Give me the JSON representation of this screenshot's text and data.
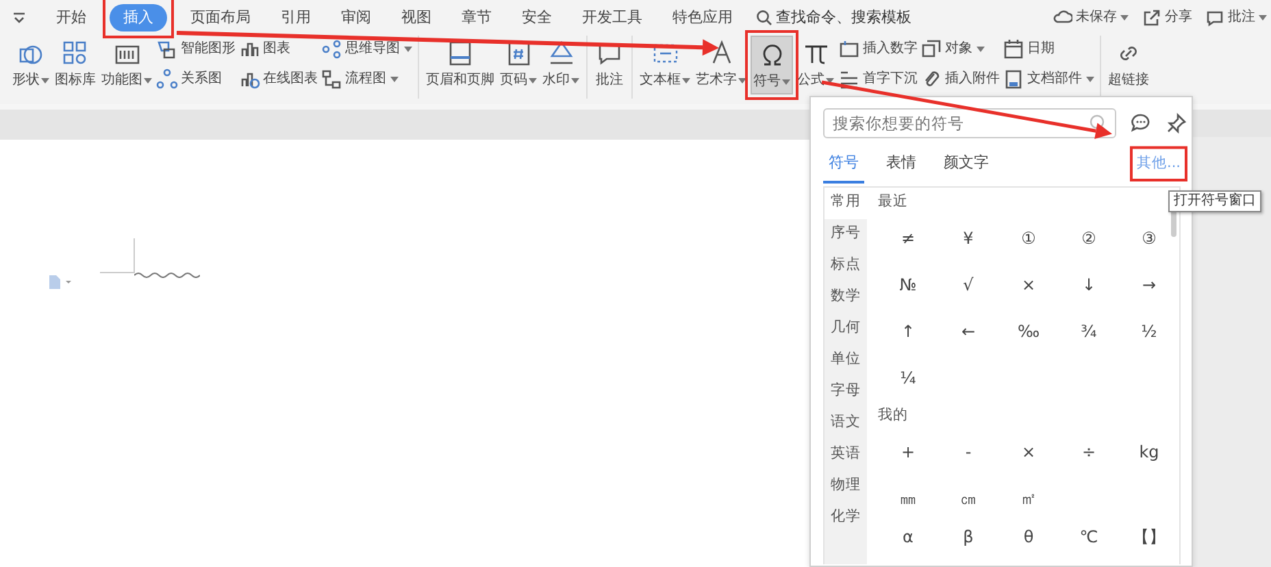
{
  "tabs": [
    {
      "label": "开始",
      "selected": false
    },
    {
      "label": "插入",
      "selected": true
    },
    {
      "label": "页面布局",
      "selected": false
    },
    {
      "label": "引用",
      "selected": false
    },
    {
      "label": "审阅",
      "selected": false
    },
    {
      "label": "视图",
      "selected": false
    },
    {
      "label": "章节",
      "selected": false
    },
    {
      "label": "安全",
      "selected": false
    },
    {
      "label": "开发工具",
      "selected": false
    },
    {
      "label": "特色应用",
      "selected": false
    }
  ],
  "command_search": "查找命令、搜索模板",
  "top_actions": [
    {
      "label": "未保存",
      "dropdown": true
    },
    {
      "label": "分享",
      "dropdown": false
    },
    {
      "label": "批注",
      "dropdown": true
    }
  ],
  "ribbon_groups": [
    {
      "items": [
        {
          "kind": "large",
          "label": "形状",
          "dropdown": true,
          "pressed": false
        },
        {
          "kind": "large",
          "label": "图标库",
          "dropdown": false,
          "pressed": false
        },
        {
          "kind": "large",
          "label": "功能图",
          "dropdown": true,
          "pressed": false
        },
        {
          "kind": "small",
          "label": "智能图形",
          "dropdown": false
        },
        {
          "kind": "small",
          "label": "关系图",
          "dropdown": false
        },
        {
          "kind": "small",
          "label": "图表",
          "dropdown": false
        },
        {
          "kind": "small",
          "label": "在线图表",
          "dropdown": false
        },
        {
          "kind": "small",
          "label": "思维导图",
          "dropdown": true
        },
        {
          "kind": "small",
          "label": "流程图",
          "dropdown": true
        }
      ]
    },
    {
      "items": [
        {
          "kind": "large",
          "label": "页眉和页脚",
          "dropdown": false,
          "pressed": false
        },
        {
          "kind": "large",
          "label": "页码",
          "dropdown": true,
          "pressed": false
        },
        {
          "kind": "large",
          "label": "水印",
          "dropdown": true,
          "pressed": false
        }
      ]
    },
    {
      "items": [
        {
          "kind": "large",
          "label": "批注",
          "dropdown": false,
          "pressed": false
        }
      ]
    },
    {
      "items": [
        {
          "kind": "large",
          "label": "文本框",
          "dropdown": true,
          "pressed": false
        },
        {
          "kind": "large",
          "label": "艺术字",
          "dropdown": true,
          "pressed": false
        },
        {
          "kind": "large",
          "label": "符号",
          "dropdown": true,
          "pressed": true
        },
        {
          "kind": "large",
          "label": "公式",
          "dropdown": true,
          "pressed": false
        },
        {
          "kind": "small",
          "label": "插入数字",
          "dropdown": false
        },
        {
          "kind": "small",
          "label": "首字下沉",
          "dropdown": false
        },
        {
          "kind": "small",
          "label": "对象",
          "dropdown": true
        },
        {
          "kind": "small",
          "label": "插入附件",
          "dropdown": false
        },
        {
          "kind": "small",
          "label": "日期",
          "dropdown": false
        },
        {
          "kind": "small",
          "label": "文档部件",
          "dropdown": true
        }
      ]
    },
    {
      "items": [
        {
          "kind": "large",
          "label": "超链接",
          "dropdown": false,
          "pressed": false
        }
      ]
    }
  ],
  "symbol_panel": {
    "search": {
      "placeholder": "搜索你想要的符号"
    },
    "tabs": [
      {
        "label": "符号",
        "selected": true
      },
      {
        "label": "表情",
        "selected": false
      },
      {
        "label": "颜文字",
        "selected": false
      }
    ],
    "more_link": "其他...",
    "tooltip": "打开符号窗口",
    "categories": [
      {
        "label": "常用",
        "selected": true
      },
      {
        "label": "序号",
        "selected": false
      },
      {
        "label": "标点",
        "selected": false
      },
      {
        "label": "数学",
        "selected": false
      },
      {
        "label": "几何",
        "selected": false
      },
      {
        "label": "单位",
        "selected": false
      },
      {
        "label": "字母",
        "selected": false
      },
      {
        "label": "语文",
        "selected": false
      },
      {
        "label": "英语",
        "selected": false
      },
      {
        "label": "物理",
        "selected": false
      },
      {
        "label": "化学",
        "selected": false
      }
    ],
    "sections": [
      {
        "title": "最近",
        "rows": [
          [
            "≠",
            "¥",
            "①",
            "②",
            "③"
          ],
          [
            "№",
            "√",
            "×",
            "↓",
            "→"
          ],
          [
            "↑",
            "←",
            "‰",
            "¾",
            "½"
          ],
          [
            "¼"
          ]
        ]
      },
      {
        "title": "我的",
        "rows": [
          [
            "+",
            "-",
            "×",
            "÷",
            "kg"
          ],
          [
            "㎜",
            "㎝",
            "㎡"
          ],
          [
            "α",
            "β",
            "θ",
            "℃",
            "【】"
          ]
        ]
      }
    ]
  }
}
